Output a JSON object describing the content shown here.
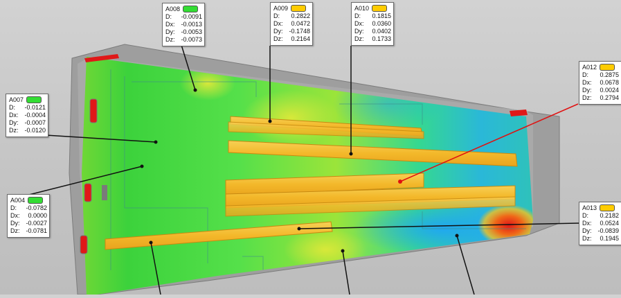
{
  "colors": {
    "pass": "#33dd33",
    "warn": "#ffcc00",
    "leader_black": "#111111",
    "leader_red": "#e01010"
  },
  "callouts": [
    {
      "id": "A008",
      "status": "pass",
      "rows": [
        [
          "D:",
          "-0.0091"
        ],
        [
          "Dx:",
          "-0.0013"
        ],
        [
          "Dy:",
          "-0.0053"
        ],
        [
          "Dz:",
          "-0.0073"
        ]
      ]
    },
    {
      "id": "A009",
      "status": "warn",
      "rows": [
        [
          "D:",
          "0.2822"
        ],
        [
          "Dx:",
          "0.0472"
        ],
        [
          "Dy:",
          "-0.1748"
        ],
        [
          "Dz:",
          "0.2164"
        ]
      ]
    },
    {
      "id": "A010",
      "status": "warn",
      "rows": [
        [
          "D:",
          "0.1815"
        ],
        [
          "Dx:",
          "0.0360"
        ],
        [
          "Dy:",
          "0.0402"
        ],
        [
          "Dz:",
          "0.1733"
        ]
      ]
    },
    {
      "id": "A012",
      "status": "warn",
      "rows": [
        [
          "D:",
          "0.2875"
        ],
        [
          "Dx:",
          "0.0678"
        ],
        [
          "Dy:",
          "0.0024"
        ],
        [
          "Dz:",
          "0.2794"
        ]
      ]
    },
    {
      "id": "A007",
      "status": "pass",
      "rows": [
        [
          "D:",
          "-0.0121"
        ],
        [
          "Dx:",
          "-0.0004"
        ],
        [
          "Dy:",
          "-0.0007"
        ],
        [
          "Dz:",
          "-0.0120"
        ]
      ]
    },
    {
      "id": "A004",
      "status": "pass",
      "rows": [
        [
          "D:",
          "-0.0782"
        ],
        [
          "Dx:",
          "0.0000"
        ],
        [
          "Dy:",
          "-0.0027"
        ],
        [
          "Dz:",
          "-0.0781"
        ]
      ]
    },
    {
      "id": "A013",
      "status": "warn",
      "rows": [
        [
          "D:",
          "0.2182"
        ],
        [
          "Dx:",
          "0.0524"
        ],
        [
          "Dy:",
          "-0.0839"
        ],
        [
          "Dz:",
          "0.1945"
        ]
      ]
    }
  ]
}
